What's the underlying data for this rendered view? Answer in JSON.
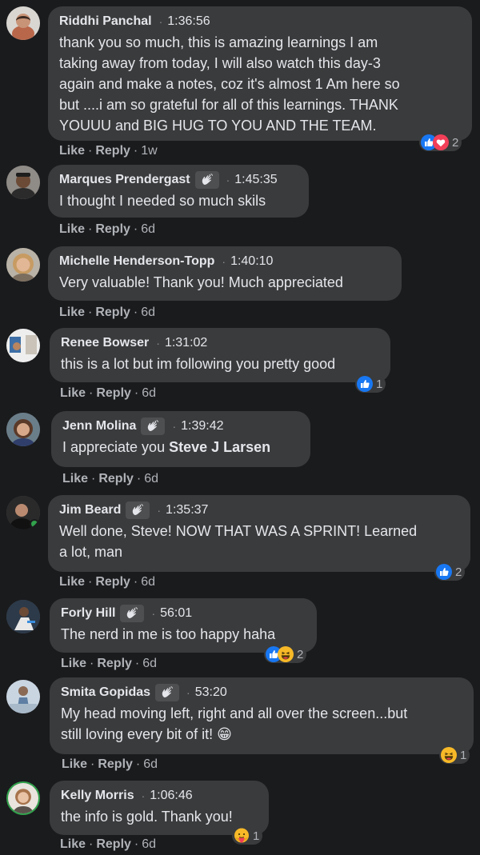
{
  "comments": [
    {
      "name": "Riddhi Panchal",
      "timestamp": "1:36:56",
      "text_lines": [
        "thank you so much, this is amazing learnings I am",
        "taking away from today, I will also watch this day-3",
        "again and make a notes, coz it's almost 1 Am here so",
        "but ....i am so grateful for all of this learnings. THANK",
        "YOUUU and BIG HUG TO YOU AND THE TEAM."
      ],
      "like": "Like",
      "reply": "Reply",
      "age": "1w",
      "reactions": [
        "like-icon",
        "love-icon"
      ],
      "reaction_count": "2"
    },
    {
      "name": "Marques Prendergast",
      "badge": "top-fan-icon",
      "timestamp": "1:45:35",
      "text_lines": [
        "I thought I needed so much skils"
      ],
      "like": "Like",
      "reply": "Reply",
      "age": "6d"
    },
    {
      "name": "Michelle Henderson-Topp",
      "timestamp": "1:40:10",
      "text_lines": [
        "Very valuable! Thank you! Much appreciated"
      ],
      "like": "Like",
      "reply": "Reply",
      "age": "6d"
    },
    {
      "name": "Renee Bowser",
      "timestamp": "1:31:02",
      "text_lines": [
        "this is a lot but im following you pretty good"
      ],
      "like": "Like",
      "reply": "Reply",
      "age": "6d",
      "reactions": [
        "like-icon"
      ],
      "reaction_count": "1"
    },
    {
      "name": "Jenn Molina",
      "badge": "top-fan-icon",
      "timestamp": "1:39:42",
      "text_prefix": "I appreciate you ",
      "text_mention": "Steve J Larsen",
      "like": "Like",
      "reply": "Reply",
      "age": "6d"
    },
    {
      "name": "Jim Beard",
      "badge": "top-fan-icon",
      "timestamp": "1:35:37",
      "text_lines": [
        "Well done, Steve! NOW THAT WAS A SPRINT! Learned",
        "a lot, man"
      ],
      "like": "Like",
      "reply": "Reply",
      "age": "6d",
      "reactions": [
        "like-icon"
      ],
      "reaction_count": "2"
    },
    {
      "name": "Forly Hill",
      "badge": "top-fan-icon",
      "timestamp": "56:01",
      "text_lines": [
        "The nerd in me is too happy haha"
      ],
      "like": "Like",
      "reply": "Reply",
      "age": "6d",
      "reactions": [
        "like-icon",
        "haha-icon"
      ],
      "reaction_count": "2"
    },
    {
      "name": "Smita Gopidas",
      "badge": "top-fan-icon",
      "timestamp": "53:20",
      "text_lines": [
        "My head moving left, right and all over the screen...but",
        "still loving every bit of it! 😁"
      ],
      "like": "Like",
      "reply": "Reply",
      "age": "6d",
      "reactions": [
        "haha-icon"
      ],
      "reaction_count": "1"
    },
    {
      "name": "Kelly Morris",
      "timestamp": "1:06:46",
      "text_lines": [
        "the info is gold. Thank you!"
      ],
      "like": "Like",
      "reply": "Reply",
      "age": "6d",
      "reactions": [
        "care-icon"
      ],
      "reaction_count": "1"
    }
  ],
  "colors": {
    "background": "#1a1b1d",
    "bubble": "#3a3b3c",
    "text": "#e4e6eb",
    "secondary_text": "#b0b3b8",
    "like_blue": "#1877f2",
    "love_red": "#f33e58",
    "haha_yellow": "#f7b928"
  }
}
